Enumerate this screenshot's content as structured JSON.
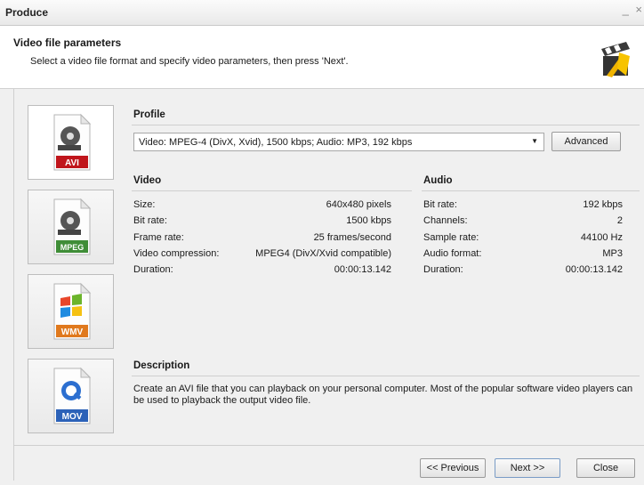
{
  "window": {
    "title": "Produce",
    "controls": "_ ×"
  },
  "header": {
    "title": "Video file parameters",
    "subtitle": "Select a video file format and specify video parameters, then press 'Next'."
  },
  "formats": [
    {
      "label": "AVI",
      "color": "#c0151b",
      "selected": true
    },
    {
      "label": "MPEG",
      "color": "#3f8d37",
      "selected": false
    },
    {
      "label": "WMV",
      "color": "#e0791d",
      "selected": false
    },
    {
      "label": "MOV",
      "color": "#2c62b8",
      "selected": false
    }
  ],
  "profile": {
    "heading": "Profile",
    "selected": "Video: MPEG-4 (DivX, Xvid), 1500 kbps; Audio: MP3, 192 kbps",
    "advanced_label": "Advanced"
  },
  "video": {
    "heading": "Video",
    "rows": [
      {
        "label": "Size:",
        "value": "640x480 pixels"
      },
      {
        "label": "Bit rate:",
        "value": "1500 kbps"
      },
      {
        "label": "Frame rate:",
        "value": "25 frames/second"
      },
      {
        "label": "Video compression:",
        "value": "MPEG4 (DivX/Xvid compatible)"
      },
      {
        "label": "Duration:",
        "value": "00:00:13.142"
      }
    ]
  },
  "audio": {
    "heading": "Audio",
    "rows": [
      {
        "label": "Bit rate:",
        "value": "192 kbps"
      },
      {
        "label": "Channels:",
        "value": "2"
      },
      {
        "label": "Sample rate:",
        "value": "44100 Hz"
      },
      {
        "label": "Audio format:",
        "value": "MP3"
      },
      {
        "label": "Duration:",
        "value": "00:00:13.142"
      }
    ]
  },
  "description": {
    "heading": "Description",
    "text": "Create an AVI file that you can playback on your personal computer. Most of the popular software video players can be used to playback the output video file."
  },
  "footer": {
    "previous_label": "<< Previous",
    "next_label": "Next >>",
    "close_label": "Close"
  }
}
